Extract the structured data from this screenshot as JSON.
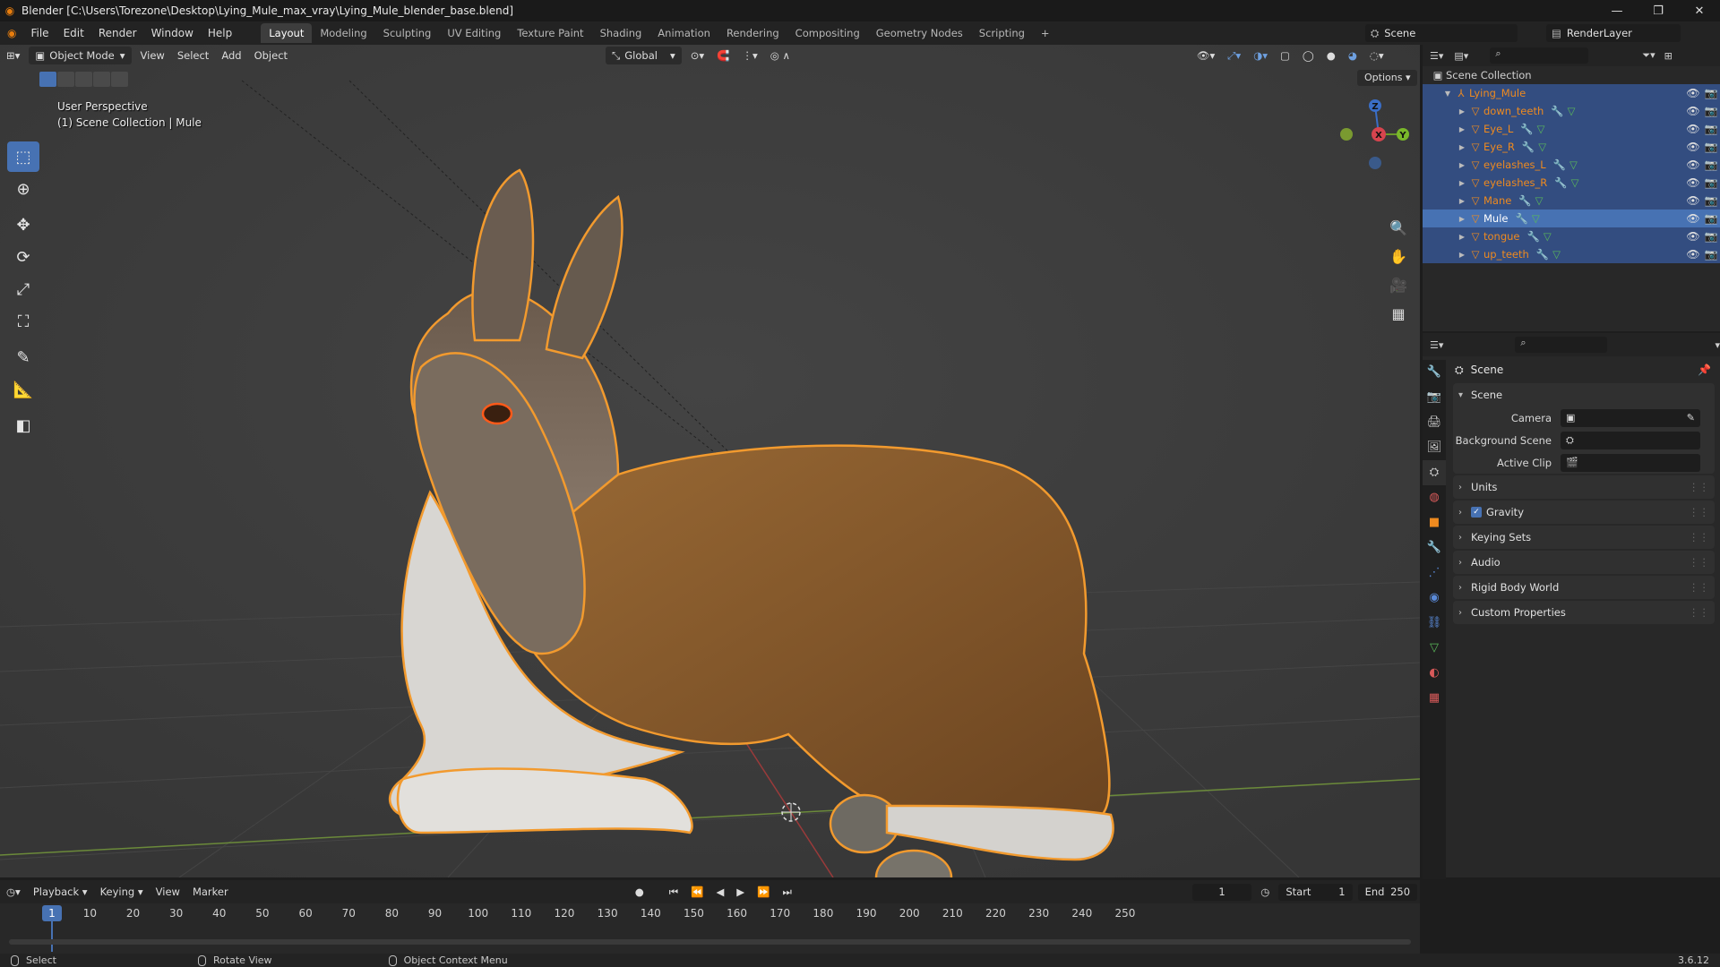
{
  "window": {
    "title": "Blender [C:\\Users\\Torezone\\Desktop\\Lying_Mule_max_vray\\Lying_Mule_blender_base.blend]",
    "minimize": "—",
    "maximize": "❐",
    "close": "✕"
  },
  "menubar": {
    "items": [
      "File",
      "Edit",
      "Render",
      "Window",
      "Help"
    ],
    "workspaces": [
      "Layout",
      "Modeling",
      "Sculpting",
      "UV Editing",
      "Texture Paint",
      "Shading",
      "Animation",
      "Rendering",
      "Compositing",
      "Geometry Nodes",
      "Scripting"
    ],
    "active_workspace": "Layout",
    "add_workspace": "+",
    "scene": "Scene",
    "view_layer": "RenderLayer"
  },
  "viewport": {
    "mode": "Object Mode",
    "menus": [
      "View",
      "Select",
      "Add",
      "Object"
    ],
    "transform_orientation": "Global",
    "options": "Options",
    "perspective": "User Perspective",
    "collection_info": "(1) Scene Collection | Mule",
    "gizmo_axes": {
      "z": "Z",
      "x": "X",
      "y": "Y"
    }
  },
  "outliner": {
    "root": "Scene Collection",
    "collection": "Lying_Mule",
    "objects": [
      "down_teeth",
      "Eye_L",
      "Eye_R",
      "eyelashes_L",
      "eyelashes_R",
      "Mane",
      "Mule",
      "tongue",
      "up_teeth"
    ],
    "active_object": "Mule"
  },
  "properties": {
    "context": "Scene",
    "scene_panel": {
      "title": "Scene",
      "camera_label": "Camera",
      "background_scene_label": "Background Scene",
      "active_clip_label": "Active Clip"
    },
    "panels": [
      "Units",
      "Gravity",
      "Keying Sets",
      "Audio",
      "Rigid Body World",
      "Custom Properties"
    ],
    "gravity_enabled": true
  },
  "timeline": {
    "menus": [
      "Playback",
      "Keying",
      "View",
      "Marker"
    ],
    "current_frame": "1",
    "start_label": "Start",
    "start": "1",
    "end_label": "End",
    "end": "250",
    "ticks": [
      "1",
      "10",
      "20",
      "30",
      "40",
      "50",
      "60",
      "70",
      "80",
      "90",
      "100",
      "110",
      "120",
      "130",
      "140",
      "150",
      "160",
      "170",
      "180",
      "190",
      "200",
      "210",
      "220",
      "230",
      "240",
      "250"
    ]
  },
  "statusbar": {
    "left": "Select",
    "middle": "Rotate View",
    "right": "Object Context Menu",
    "version": "3.6.12"
  },
  "colors": {
    "accent": "#4772b3",
    "object_name": "#ee8a1f",
    "selection_outline": "#f29a2e",
    "viewport_bg": "#3b3b3b"
  }
}
